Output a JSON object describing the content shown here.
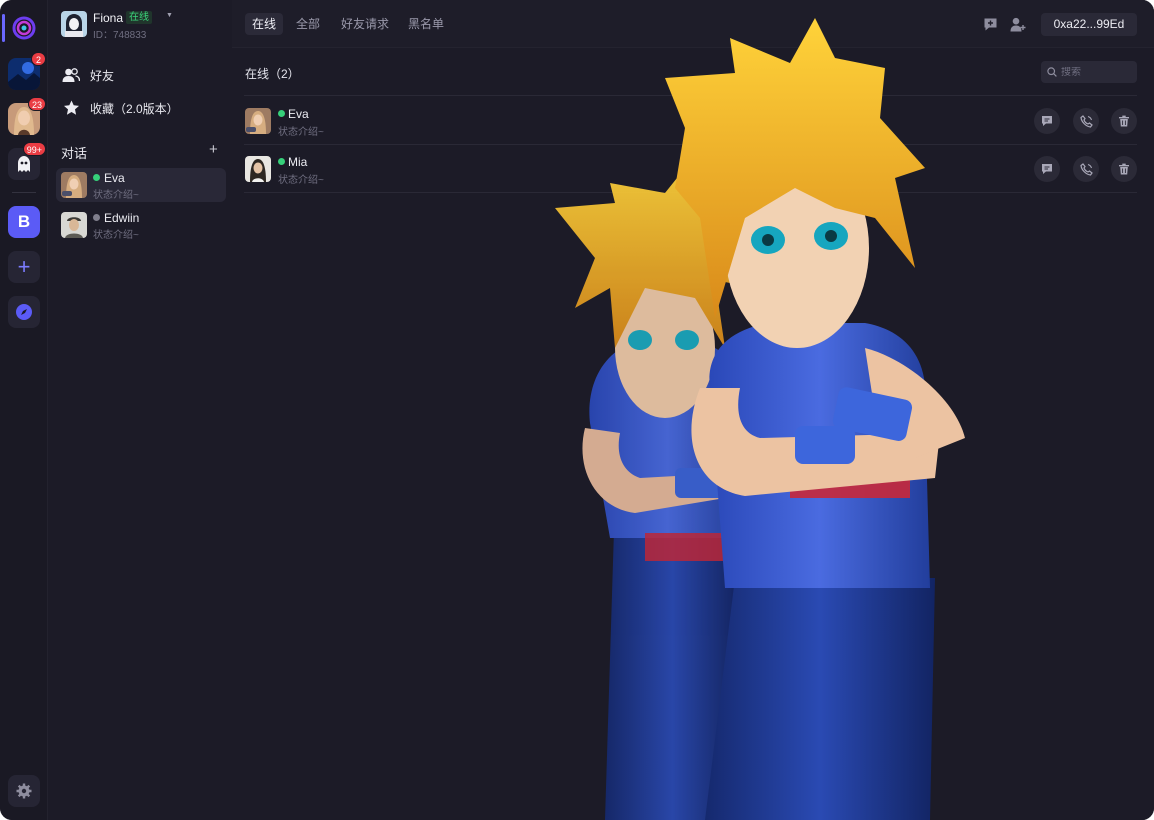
{
  "rail": {
    "items": [
      {
        "name": "app-logo",
        "badge": ""
      },
      {
        "name": "server-landscape",
        "badge": "2"
      },
      {
        "name": "server-portrait",
        "badge": "23"
      },
      {
        "name": "server-ghost",
        "badge": "99+"
      }
    ],
    "b_label": "B",
    "plus_label": "+"
  },
  "profile": {
    "name": "Fiona",
    "status": "在线",
    "id_text": "ID：748833"
  },
  "nav": {
    "friends": "好友",
    "favorites": "收藏（2.0版本）"
  },
  "conversations": {
    "title": "对话",
    "add": "+",
    "items": [
      {
        "name": "Eva",
        "status_text": "状态介绍~",
        "online": true
      },
      {
        "name": "Edwiin",
        "status_text": "状态介绍~",
        "online": false
      }
    ]
  },
  "tabs": [
    "在线",
    "全部",
    "好友请求",
    "黑名单"
  ],
  "wallet": "0xa22...99Ed",
  "list": {
    "title": "在线（2）",
    "search_placeholder": "搜索",
    "friends": [
      {
        "name": "Eva",
        "status_text": "状态介绍~"
      },
      {
        "name": "Mia",
        "status_text": "状态介绍~"
      }
    ]
  },
  "colors": {
    "accent": "#5b5bf6",
    "online": "#36d07a",
    "badge": "#ea3c43",
    "background": "#1c1b27"
  }
}
